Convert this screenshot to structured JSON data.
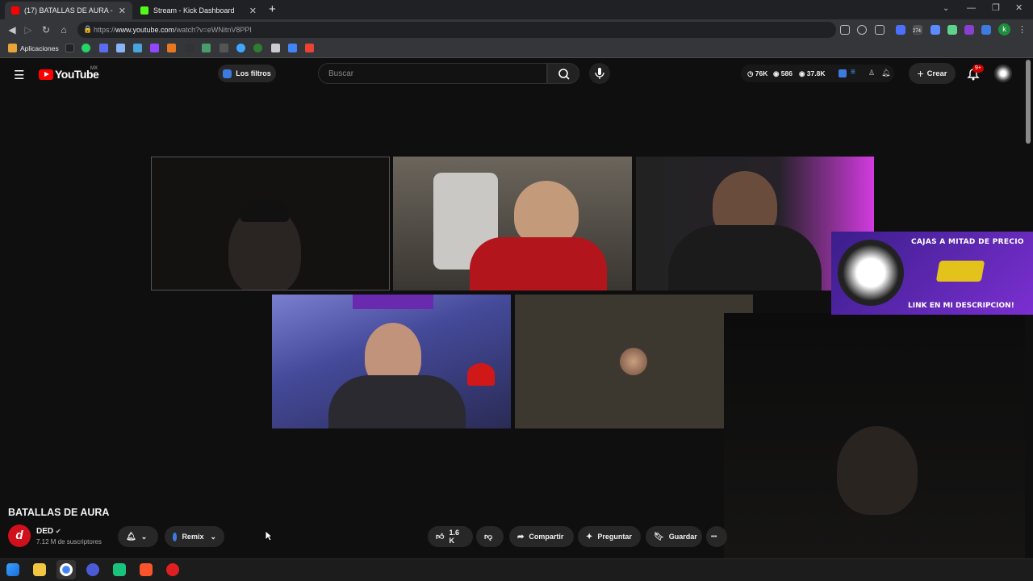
{
  "browser": {
    "tabs": [
      {
        "label": "(17) BATALLAS DE AURA - Y",
        "active": true
      },
      {
        "label": "Stream - Kick Dashboard",
        "active": false
      }
    ],
    "new_tab": "+",
    "url_prefix": "https://",
    "url_host": "www.youtube.com",
    "url_path": "/watch?v=eWNitnV8PPI",
    "bookmarks_label": "Aplicaciones",
    "extension_badge": "274",
    "profile_initial": "k"
  },
  "youtube": {
    "logo_word": "YouTube",
    "logo_region": "MX",
    "filters_label": "Los filtros",
    "search_placeholder": "Buscar",
    "stats": {
      "likes": "76K",
      "viewers": "586",
      "views": "37.8K"
    },
    "create_label": "Crear",
    "notif_badge": "9+",
    "overlay_top": "CAJAS A MITAD DE PRECIO",
    "overlay_bottom": "LINK EN MI DESCRIPCION!"
  },
  "video": {
    "title": "BATALLAS DE AURA",
    "channel_name": "DED",
    "subscribers": "7.12 M de suscriptores",
    "remix_label": "Remix",
    "like_count": "1.6 K",
    "share_label": "Compartir",
    "ask_label": "Preguntar",
    "save_label": "Guardar",
    "more_label": "•••"
  },
  "colors": {
    "brand_red": "#ff0000",
    "kick_green": "#53fc18",
    "accent_blue": "#3ea6ff"
  }
}
